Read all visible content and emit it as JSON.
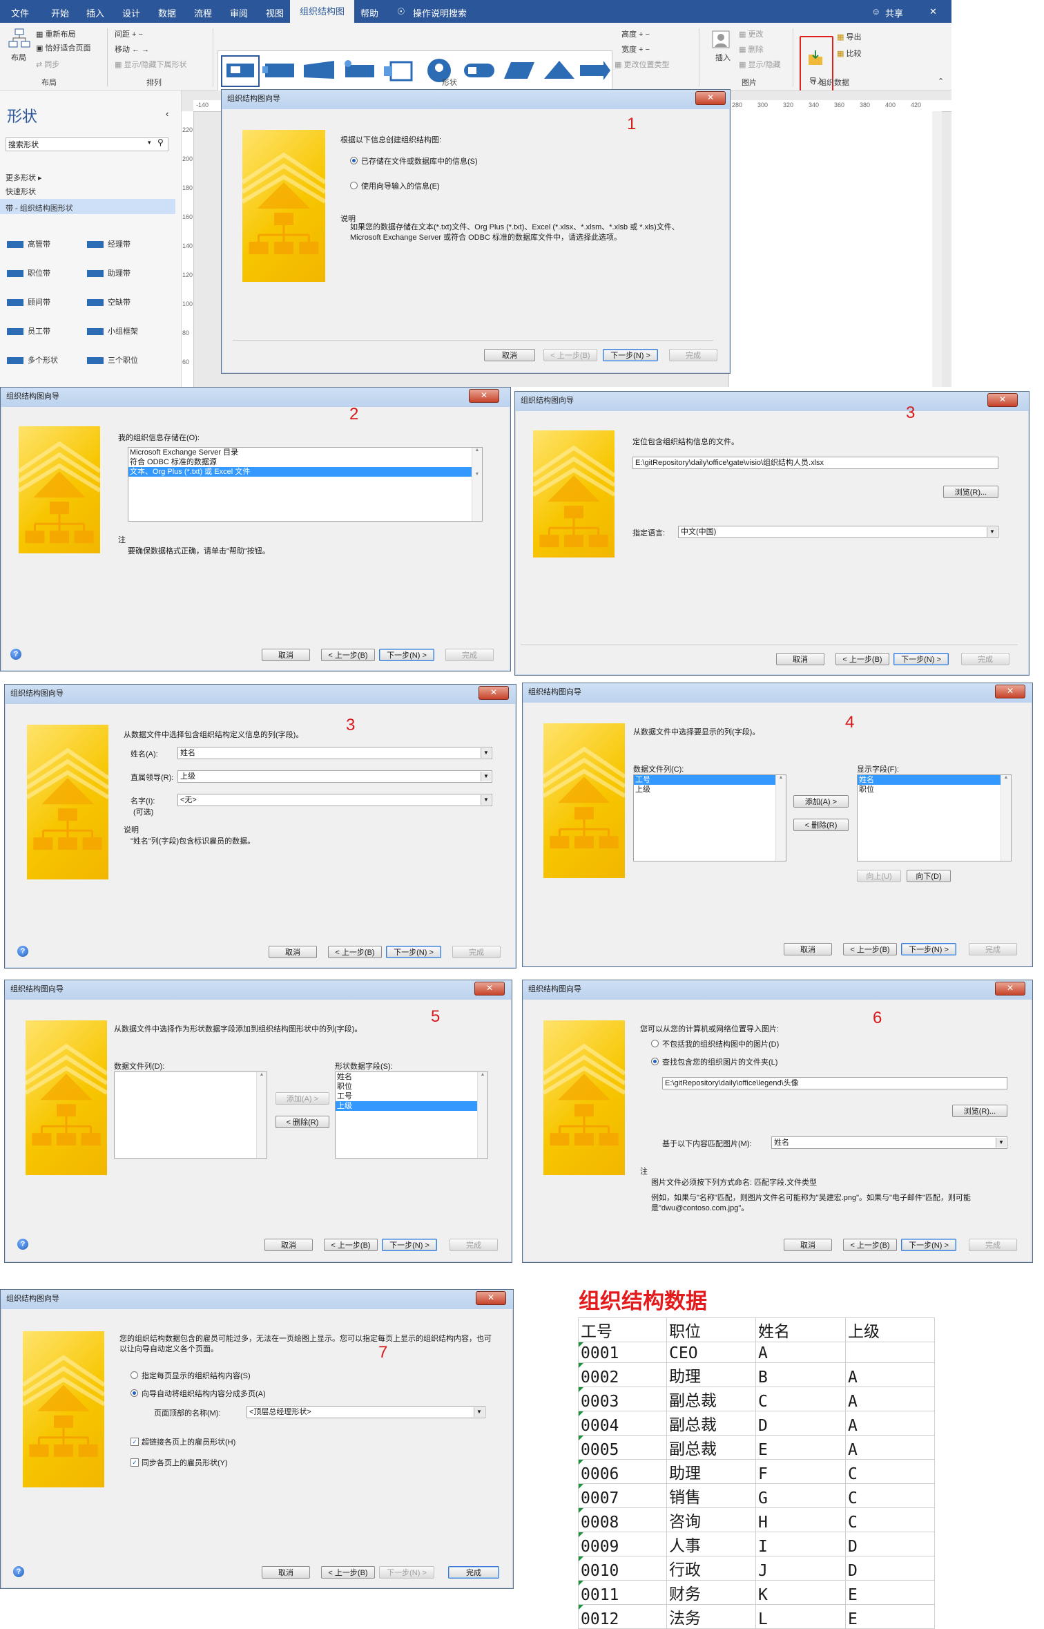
{
  "visio": {
    "menu": [
      "文件",
      "开始",
      "插入",
      "设计",
      "数据",
      "流程",
      "审阅",
      "视图",
      "组织结构图",
      "帮助"
    ],
    "tell_me": "操作说明搜索",
    "share": "共享",
    "ribbon": {
      "layout_label": "布局",
      "relayout": "重新布局",
      "fit_page": "恰好适合页面",
      "sync": "同步",
      "group_layout": "布局",
      "spacing": "间距",
      "move": "移动",
      "show_hide_subordinates": "显示/隐藏下属形状",
      "group_arrange": "排列",
      "group_shapes": "形状",
      "height": "高度",
      "width": "宽度",
      "change_position_type": "更改位置类型",
      "insert": "插入",
      "change": "更改",
      "delete": "删除",
      "show_picture": "显示/隐藏",
      "group_picture": "图片",
      "import": "导入",
      "export": "导出",
      "compare": "比较",
      "group_org_data": "组织数据"
    },
    "shapes_pane": {
      "title": "形状",
      "search_placeholder": "搜索形状",
      "more_shapes": "更多形状",
      "quick_shapes": "快速形状",
      "stencil": "带 - 组织结构图形状",
      "items": [
        "高管带",
        "经理带",
        "职位带",
        "助理带",
        "顾问带",
        "空缺带",
        "员工带",
        "小组框架",
        "多个形状",
        "三个职位"
      ]
    },
    "ruler_h": [
      "-140",
      "280",
      "300",
      "320",
      "340",
      "360",
      "380",
      "400",
      "420"
    ],
    "ruler_v": [
      "220",
      "200",
      "180",
      "160",
      "140",
      "120",
      "100",
      "80",
      "60"
    ]
  },
  "wizard_title": "组织结构图向导",
  "buttons": {
    "cancel": "取消",
    "back": "< 上一步(B)",
    "next": "下一步(N) >",
    "finish": "完成"
  },
  "steps": {
    "s1": "1",
    "s2": "2",
    "s3a": "3",
    "s3b": "3",
    "s4a": "4",
    "s5": "5",
    "s6": "6",
    "s7": "7"
  },
  "d1": {
    "prompt": "根据以下信息创建组织结构图:",
    "opt1": "已存储在文件或数据库中的信息(S)",
    "opt2": "使用向导输入的信息(E)",
    "desc_label": "说明",
    "desc": "如果您的数据存储在文本(*.txt)文件、Org Plus (*.txt)、Excel (*.xlsx、*.xlsm、*.xlsb 或 *.xls)文件、Microsoft Exchange Server 或符合 ODBC 标准的数据库文件中，请选择此选项。"
  },
  "d2": {
    "prompt": "我的组织信息存储在(O):",
    "items": [
      "Microsoft Exchange Server 目录",
      "符合 ODBC 标准的数据源",
      "文本、Org Plus (*.txt) 或 Excel 文件"
    ],
    "note_label": "注",
    "note": "要确保数据格式正确，请单击\"帮助\"按钮。"
  },
  "d3": {
    "prompt": "定位包含组织结构信息的文件。",
    "path": "E:\\gitRepository\\daily\\office\\gate\\visio\\组织结构人员.xlsx",
    "browse": "浏览(R)...",
    "lang_label": "指定语言:",
    "lang": "中文(中国)"
  },
  "d4": {
    "prompt": "从数据文件中选择包含组织结构定义信息的列(字段)。",
    "name_label": "姓名(A):",
    "name": "姓名",
    "mgr_label": "直属领导(R):",
    "mgr": "上级",
    "first_label": "名字(I):",
    "first_opt": "(可选)",
    "first": "<无>",
    "desc_label": "说明",
    "desc": "\"姓名\"列(字段)包含标识雇员的数据。"
  },
  "d5": {
    "prompt": "从数据文件中选择要显示的列(字段)。",
    "src_label": "数据文件列(C):",
    "src": [
      "工号",
      "上级"
    ],
    "add": "添加(A) >",
    "remove": "< 删除(R)",
    "dst_label": "显示字段(F):",
    "dst": [
      "姓名",
      "职位"
    ],
    "up": "向上(U)",
    "down": "向下(D)"
  },
  "d6": {
    "prompt": "从数据文件中选择作为形状数据字段添加到组织结构图形状中的列(字段)。",
    "src_label": "数据文件列(D):",
    "add": "添加(A) >",
    "remove": "< 删除(R)",
    "dst_label": "形状数据字段(S):",
    "dst": [
      "姓名",
      "职位",
      "工号",
      "上级"
    ]
  },
  "d7": {
    "prompt": "您可以从您的计算机或网络位置导入图片:",
    "opt1": "不包括我的组织结构图中的图片(D)",
    "opt2": "查找包含您的组织图片的文件夹(L)",
    "path": "E:\\gitRepository\\daily\\office\\legend\\头像",
    "browse": "浏览(R)...",
    "match_label": "基于以下内容匹配图片(M):",
    "match": "姓名",
    "note_label": "注",
    "note1": "图片文件必须按下列方式命名: 匹配字段.文件类型",
    "note2": "例如，如果与\"名称\"匹配，则图片文件名可能称为\"吴建宏.png\"。如果与\"电子邮件\"匹配，则可能是\"dwu@contoso.com.jpg\"。"
  },
  "d8": {
    "prompt": "您的组织结构数据包含的雇员可能过多，无法在一页绘图上显示。您可以指定每页上显示的组织结构内容，也可以让向导自动定义各个页面。",
    "opt1": "指定每页显示的组织结构内容(S)",
    "opt2": "向导自动将组织结构内容分成多页(A)",
    "page_name_label": "页面顶部的名称(M):",
    "page_name": "<顶层总经理形状>",
    "chk1": "超链接各页上的雇员形状(H)",
    "chk2": "同步各页上的雇员形状(Y)"
  },
  "table": {
    "title": "组织结构数据",
    "headers": [
      "工号",
      "职位",
      "姓名",
      "上级"
    ],
    "rows": [
      [
        "0001",
        "CEO",
        "A",
        ""
      ],
      [
        "0002",
        "助理",
        "B",
        "A"
      ],
      [
        "0003",
        "副总裁",
        "C",
        "A"
      ],
      [
        "0004",
        "副总裁",
        "D",
        "A"
      ],
      [
        "0005",
        "副总裁",
        "E",
        "A"
      ],
      [
        "0006",
        "助理",
        "F",
        "C"
      ],
      [
        "0007",
        "销售",
        "G",
        "C"
      ],
      [
        "0008",
        "咨询",
        "H",
        "C"
      ],
      [
        "0009",
        "人事",
        "I",
        "D"
      ],
      [
        "0010",
        "行政",
        "J",
        "D"
      ],
      [
        "0011",
        "财务",
        "K",
        "E"
      ],
      [
        "0012",
        "法务",
        "L",
        "E"
      ]
    ]
  }
}
